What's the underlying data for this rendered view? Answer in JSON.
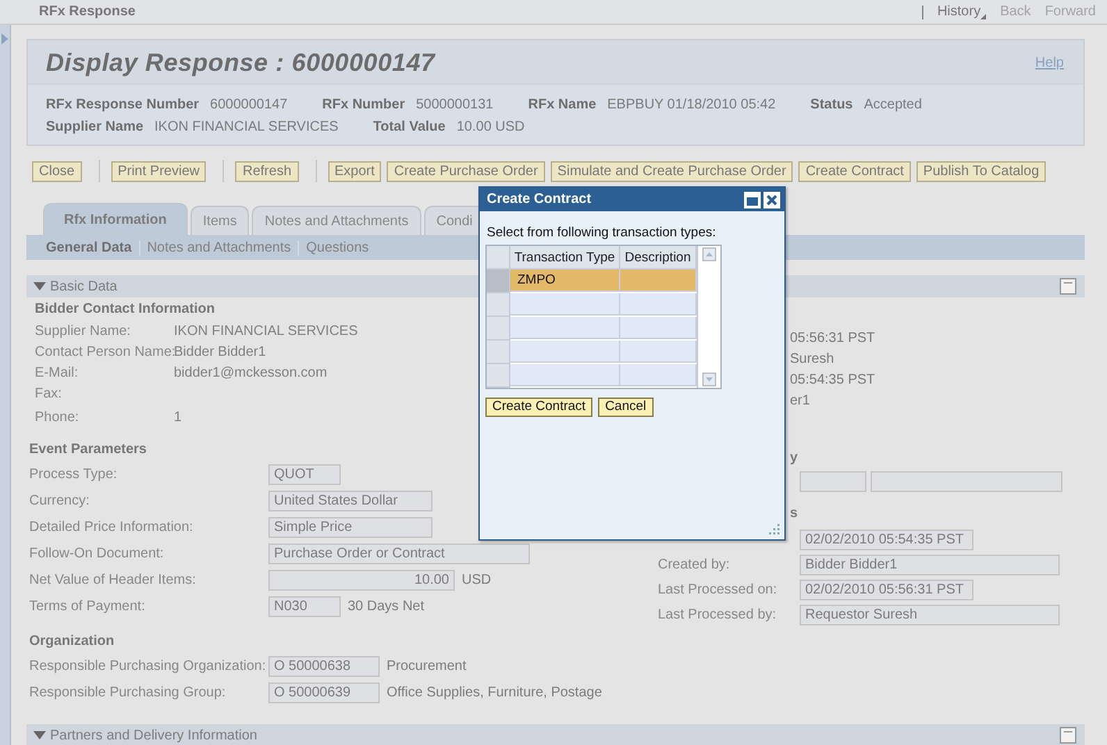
{
  "window": {
    "title": "RFx Response"
  },
  "nav": [
    {
      "label": "History",
      "disabled": false
    },
    {
      "label": "Back",
      "disabled": true
    },
    {
      "label": "Forward",
      "disabled": true
    }
  ],
  "header": {
    "title": "Display Response : 6000000147",
    "help": "Help",
    "field_rows": [
      [
        {
          "label": "RFx Response Number",
          "value": "6000000147"
        },
        {
          "label": "RFx Number",
          "value": "5000000131"
        },
        {
          "label": "RFx Name",
          "value": "EBPBUY 01/18/2010 05:42"
        },
        {
          "label": "Status",
          "value": "Accepted"
        }
      ],
      [
        {
          "label": "Supplier Name",
          "value": "IKON FINANCIAL SERVICES"
        },
        {
          "label": "Total Value",
          "value": "10.00 USD"
        }
      ]
    ]
  },
  "toolbar": [
    [
      "Close"
    ],
    [
      "Print Preview"
    ],
    [
      "Refresh"
    ],
    [
      "Export",
      "Create Purchase Order",
      "Simulate and Create Purchase Order",
      "Create Contract",
      "Publish To Catalog"
    ]
  ],
  "tabs": [
    {
      "label": "Rfx Information",
      "selected": true
    },
    {
      "label": "Items",
      "selected": false
    },
    {
      "label": "Notes and Attachments",
      "selected": false
    },
    {
      "label": "Condi",
      "selected": false
    }
  ],
  "subtabs": [
    {
      "label": "General Data",
      "selected": true
    },
    {
      "label": "Notes and Attachments",
      "selected": false
    },
    {
      "label": "Questions",
      "selected": false
    }
  ],
  "basic_data": {
    "title": "Basic Data",
    "expanded": true,
    "bidder_contact": {
      "title": "Bidder Contact Information",
      "rows": [
        {
          "label": "Supplier Name:",
          "value": "IKON FINANCIAL SERVICES"
        },
        {
          "label": "Contact Person Name:",
          "value": "Bidder Bidder1"
        },
        {
          "label": "E-Mail:",
          "value": "bidder1@mckesson.com"
        },
        {
          "label": "Fax:"
        },
        {
          "label": "Phone:",
          "value": "1"
        }
      ]
    },
    "event_parameters": {
      "title": "Event Parameters",
      "rows": [
        {
          "label": "Process Type:",
          "value": "QUOT",
          "kind": "short"
        },
        {
          "label": "Currency:",
          "value": "United States Dollar",
          "kind": "medium"
        },
        {
          "label": "Detailed Price Information:",
          "value": "Simple Price",
          "kind": "medium"
        },
        {
          "label": "Follow-On Document:",
          "value": "Purchase Order or Contract",
          "kind": "long"
        },
        {
          "label": "Net Value of Header Items:",
          "value": "10.00",
          "kind": "amount",
          "extra": "USD"
        },
        {
          "label": "Terms of Payment:",
          "value": "N030",
          "kind": "short",
          "extra": "30 Days Net"
        }
      ]
    },
    "organization": {
      "title": "Organization",
      "rows": [
        {
          "label": "Responsible Purchasing Organization:",
          "value": "O 50000638",
          "kind": "code",
          "extra": "Procurement"
        },
        {
          "label": "Responsible Purchasing Group:",
          "value": "O 50000639",
          "kind": "code",
          "extra": "Office Supplies, Furniture, Postage"
        }
      ]
    },
    "right_column": [
      {
        "kind": "fragment",
        "text": "05:56:31 PST"
      },
      {
        "kind": "fragment",
        "text": "Suresh"
      },
      {
        "kind": "fragment",
        "text": "05:54:35 PST"
      },
      {
        "kind": "fragment",
        "text": "er1"
      },
      {
        "kind": "heading_fragment",
        "text": "y"
      },
      {
        "kind": "blank_fields"
      },
      {
        "kind": "heading_fragment",
        "text": "s"
      },
      {
        "kind": "date_field",
        "value": "02/02/2010 05:54:35 PST"
      },
      {
        "kind": "text_field",
        "label": "Created by:",
        "value": "Bidder Bidder1"
      },
      {
        "kind": "date_field",
        "label": "Last Processed on:",
        "value": "02/02/2010 05:56:31 PST"
      },
      {
        "kind": "text_field",
        "label": "Last Processed by:",
        "value": "Requestor Suresh"
      }
    ]
  },
  "partners": {
    "title": "Partners and Delivery Information",
    "expanded": true
  },
  "dialog": {
    "title": "Create Contract",
    "prompt": "Select from following transaction types:",
    "columns": [
      "Transaction Type",
      "Description"
    ],
    "rows": [
      {
        "transaction_type": "ZMPO",
        "selected": true
      },
      {
        "selected": false
      },
      {
        "selected": false
      },
      {
        "selected": false
      },
      {
        "selected": false
      }
    ],
    "buttons": [
      "Create Contract",
      "Cancel"
    ]
  }
}
